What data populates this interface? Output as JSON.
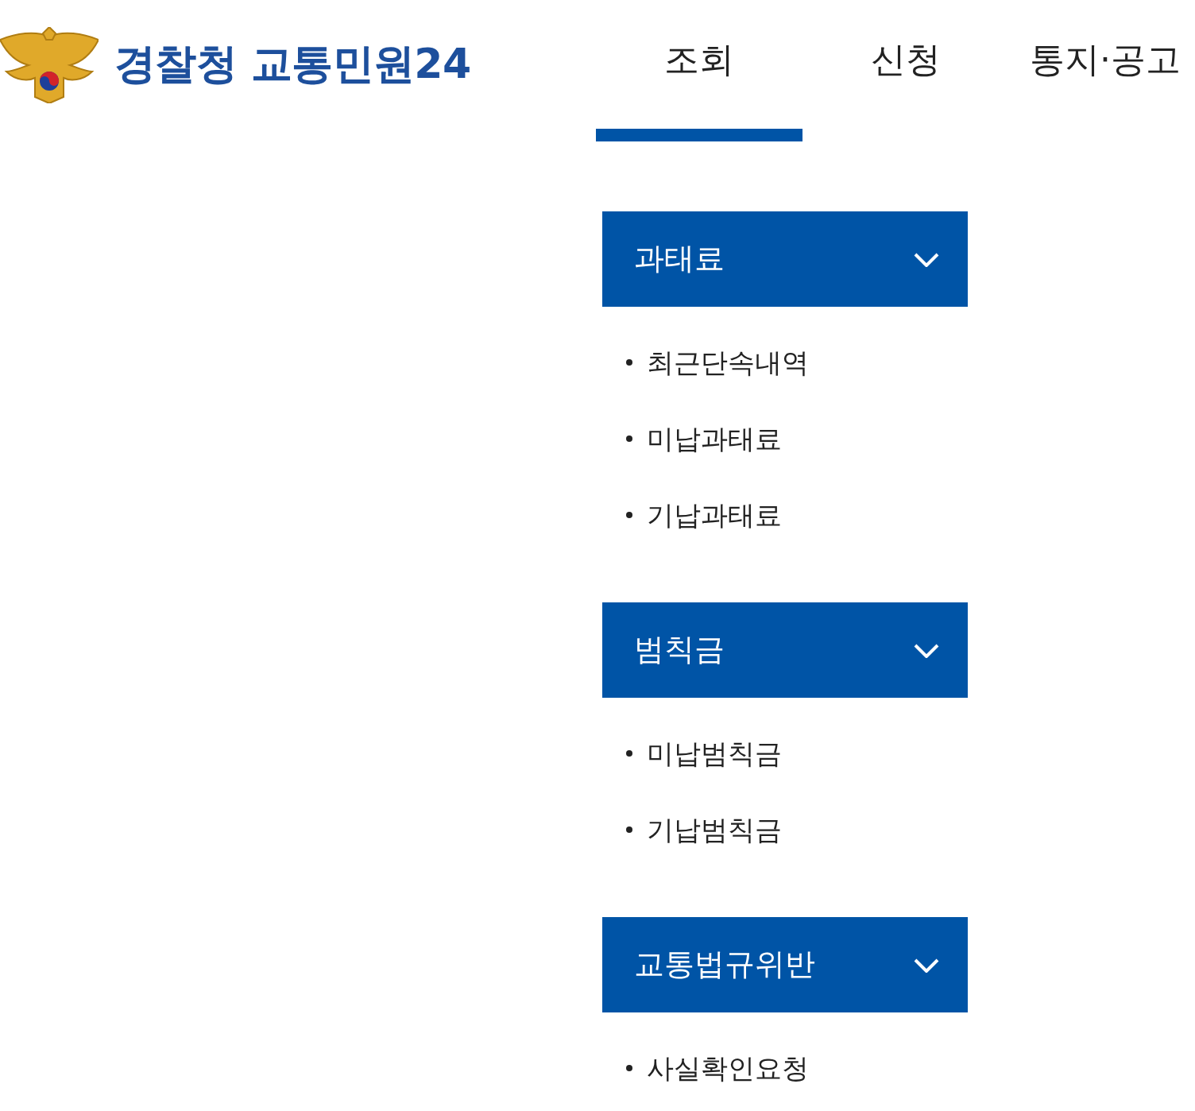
{
  "logo": {
    "text": "경찰청 교통민원24"
  },
  "nav": {
    "tabs": [
      {
        "label": "조회",
        "selected": true
      },
      {
        "label": "신청",
        "selected": false
      },
      {
        "label": "통지·공고",
        "selected": false
      }
    ]
  },
  "menu": {
    "groups": [
      {
        "title": "과태료",
        "expanded": true,
        "items": [
          "최근단속내역",
          "미납과태료",
          "기납과태료"
        ]
      },
      {
        "title": "범칙금",
        "expanded": true,
        "items": [
          "미납범칙금",
          "기납범칙금"
        ]
      },
      {
        "title": "교통법규위반",
        "expanded": true,
        "items": [
          "사실확인요청"
        ]
      }
    ]
  }
}
